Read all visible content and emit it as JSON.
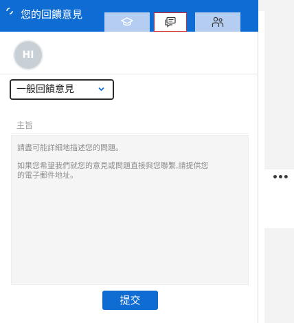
{
  "header": {
    "title": "您的回饋意見",
    "tabs": [
      {
        "icon": "graduation-cap-icon"
      },
      {
        "icon": "chat-feedback-icon",
        "active": true
      },
      {
        "icon": "people-icon"
      }
    ],
    "accent": "#0f6cd3"
  },
  "user": {
    "initials": "HI"
  },
  "feedback_type": {
    "selected": "一般回饋意見"
  },
  "subject": {
    "placeholder": "主旨"
  },
  "body": {
    "line1": "請盡可能詳細地描述您的問題。",
    "line2": "如果您希望我們就您的意見或問題直接與您聯繫,請提供您",
    "line3": "的電子郵件地址。"
  },
  "submit_label": "提交",
  "side": {
    "more_label": "•••"
  }
}
